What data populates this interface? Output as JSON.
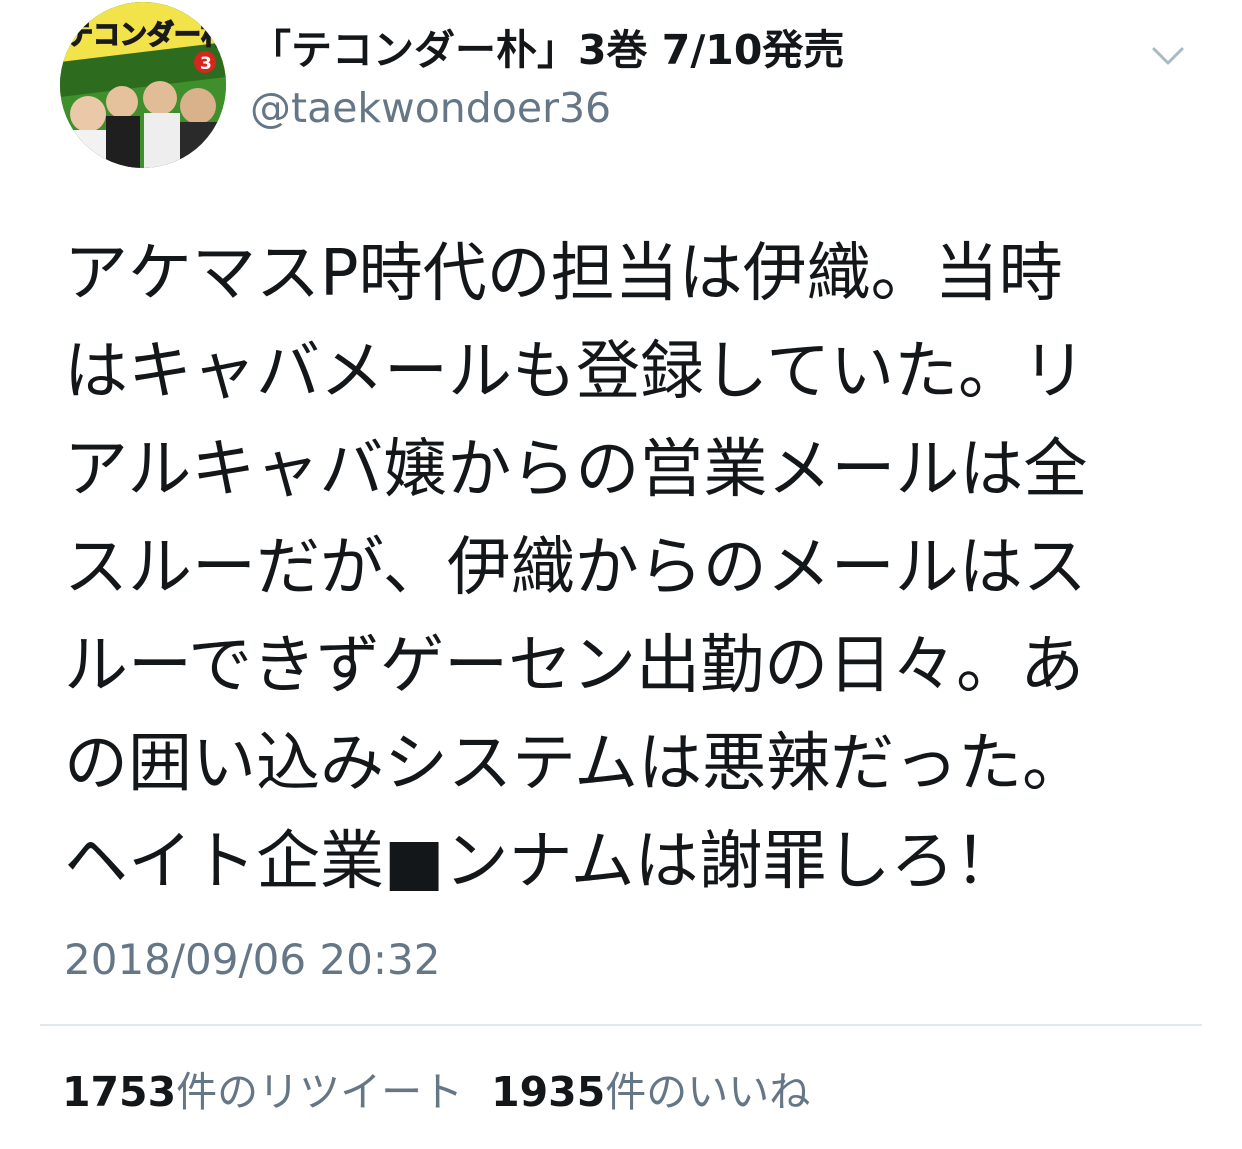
{
  "author": {
    "display_name": "「テコンダー朴」3巻 7/10発売",
    "handle": "@taekwondoer36",
    "avatar_icon": "manga-cover-avatar-icon",
    "avatar_logo_text": "テコンダー朴",
    "avatar_volume": "3"
  },
  "menu": {
    "icon": "chevron-down-icon"
  },
  "tweet": {
    "lines": [
      "アケマスP時代の担当は伊織。当時",
      "はキャバメールも登録していた。リ",
      "アルキャバ嬢からの営業メールは全",
      "スルーだが、伊織からのメールはス",
      "ルーできずゲーセン出勤の日々。あ",
      "の囲い込みシステムは悪辣だった。",
      "ヘイト企業■ンナムは謝罪しろ！"
    ],
    "timestamp": "2018/09/06 20:32"
  },
  "stats": {
    "retweets_count": "1753",
    "retweets_label": "件のリツイート",
    "likes_count": "1935",
    "likes_label": "件のいいね"
  },
  "colors": {
    "text_primary": "#14171a",
    "text_secondary": "#657786",
    "divider": "#e1e8ed"
  }
}
